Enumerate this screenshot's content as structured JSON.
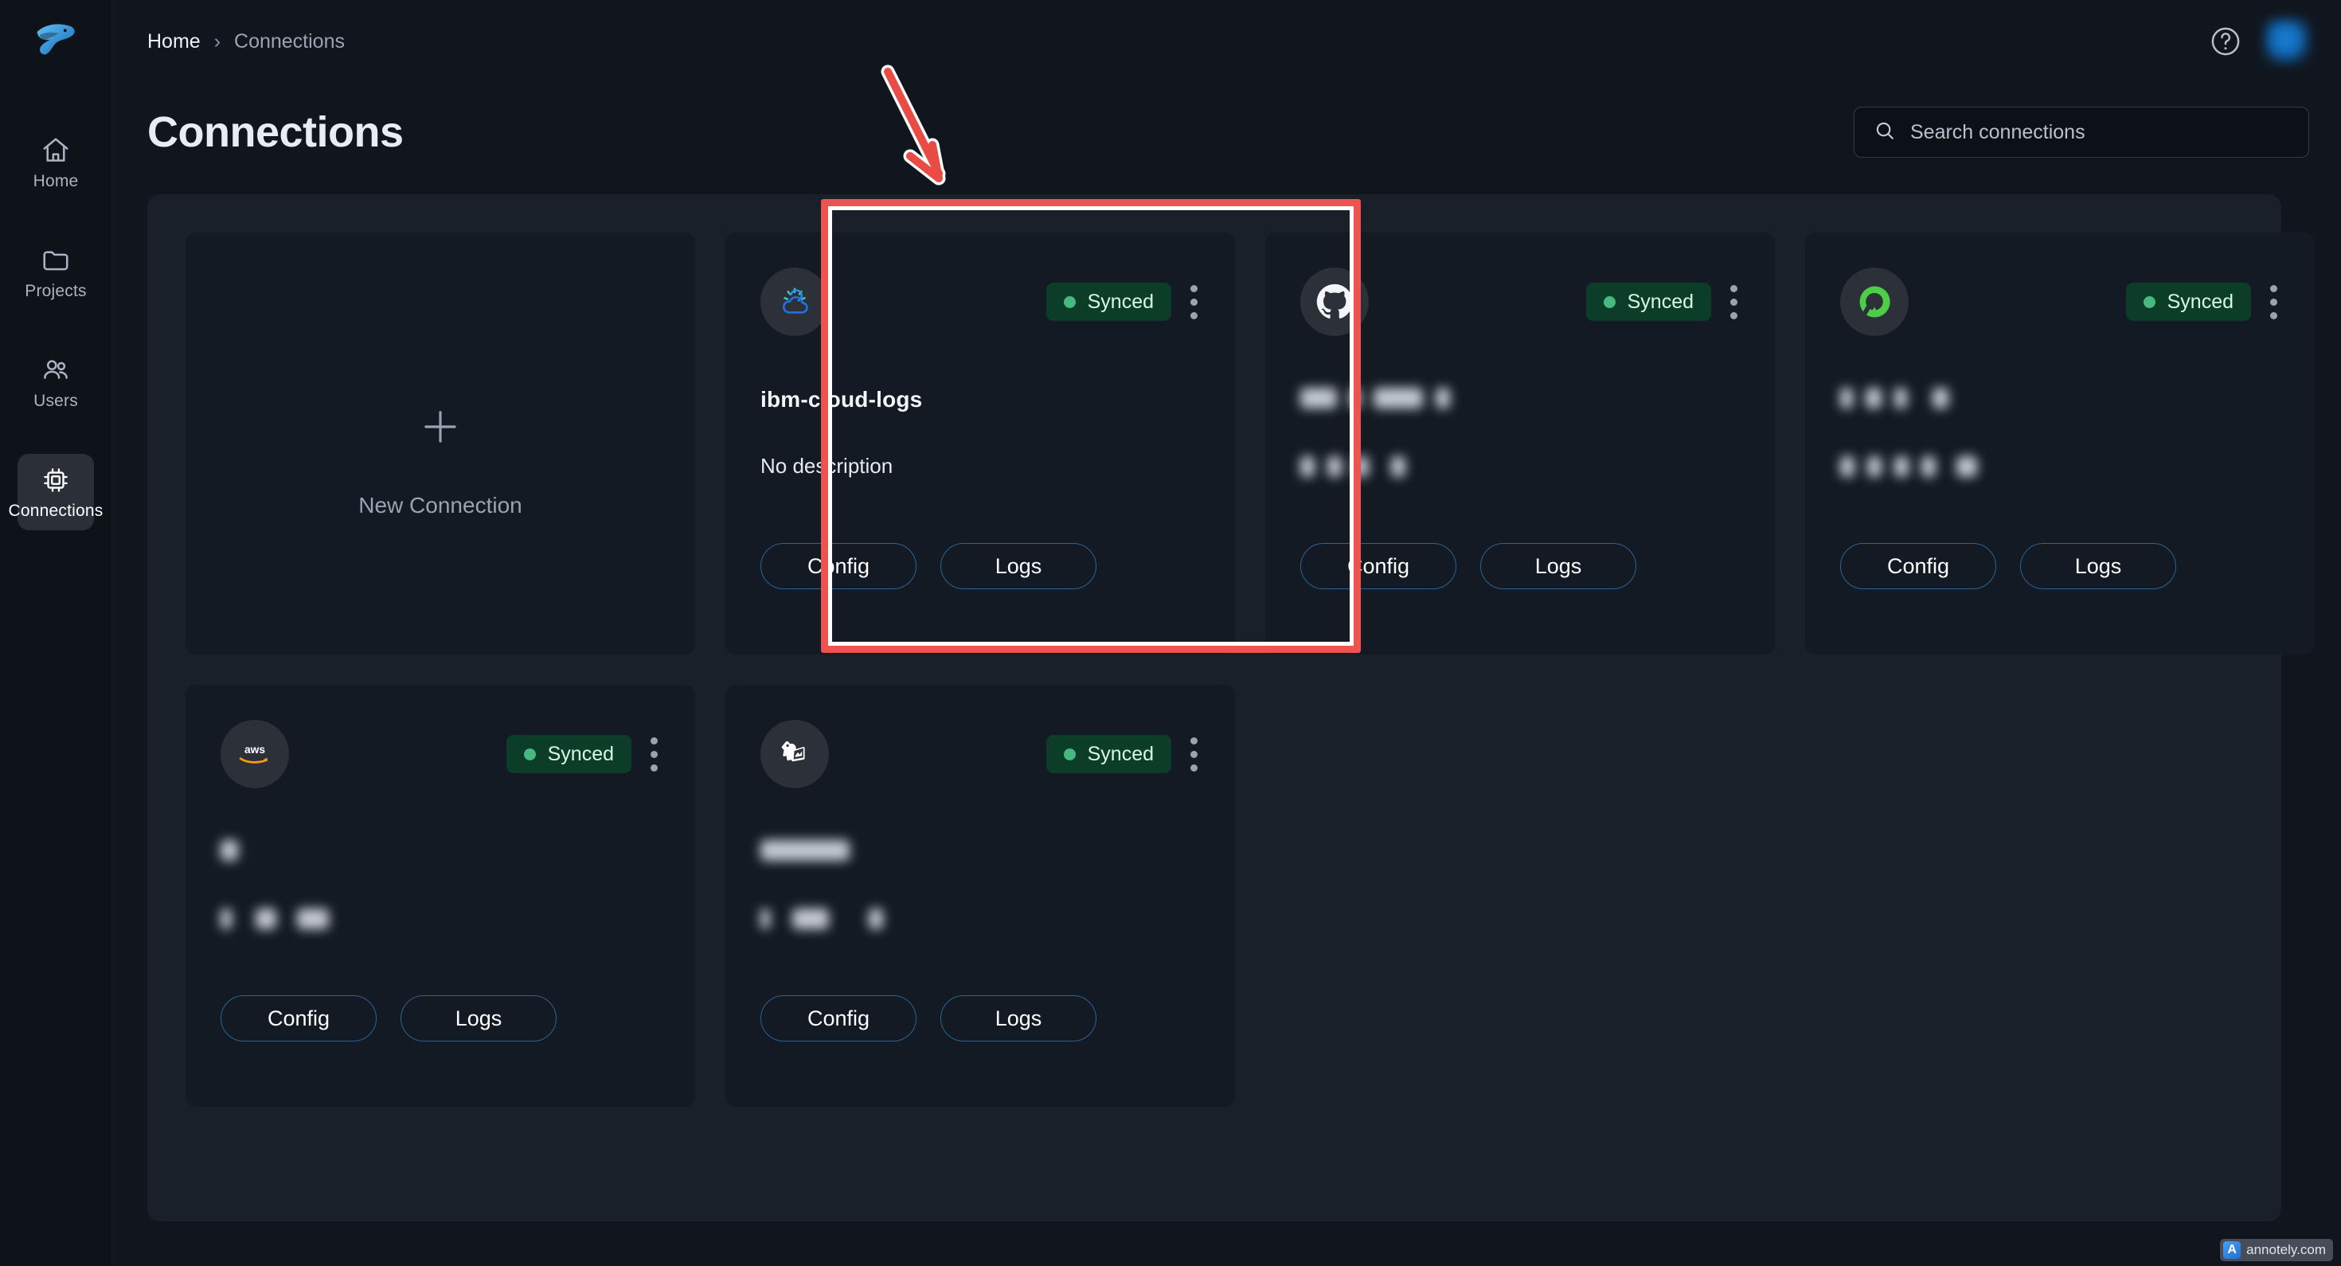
{
  "sidebar": {
    "brand_icon": "eagle-logo",
    "items": [
      {
        "label": "Home",
        "icon": "home-icon",
        "active": false
      },
      {
        "label": "Projects",
        "icon": "folder-icon",
        "active": false
      },
      {
        "label": "Users",
        "icon": "users-icon",
        "active": false
      },
      {
        "label": "Connections",
        "icon": "chip-icon",
        "active": true
      }
    ]
  },
  "topbar": {
    "breadcrumb": {
      "home": "Home",
      "separator": "›",
      "current": "Connections"
    },
    "help_icon": "help-circle-icon",
    "avatar": "user-avatar"
  },
  "header": {
    "title": "Connections"
  },
  "search": {
    "icon": "search-icon",
    "placeholder": "Search connections",
    "value": ""
  },
  "new_connection": {
    "icon": "plus-icon",
    "label": "New Connection"
  },
  "labels": {
    "config": "Config",
    "logs": "Logs",
    "synced": "Synced",
    "kebab": "more-options"
  },
  "colors": {
    "page_background": "#11161e",
    "sidebar_background": "#0e1319",
    "panel_background": "#1a2029",
    "card_background": "#131a23",
    "badge_background": "#0c3d28",
    "badge_dot": "#45b97e",
    "button_border": "#2a6397",
    "annotation_red": "#ef5350",
    "annotation_white": "#ffffff"
  },
  "connections": [
    {
      "logo": "ibm-cloud-icon",
      "status": "Synced",
      "name": "ibm-cloud-logs",
      "description": "No description",
      "name_redacted": false,
      "description_redacted": false,
      "buttons": [
        "Config",
        "Logs"
      ]
    },
    {
      "logo": "github-icon",
      "status": "Synced",
      "name": "",
      "description": "",
      "name_redacted": true,
      "description_redacted": true,
      "buttons": [
        "Config",
        "Logs"
      ]
    },
    {
      "logo": "newrelic-icon",
      "status": "Synced",
      "name": "",
      "description": "",
      "name_redacted": true,
      "description_redacted": true,
      "buttons": [
        "Config",
        "Logs"
      ]
    },
    {
      "logo": "aws-icon",
      "status": "Synced",
      "name": "",
      "description": "",
      "name_redacted": true,
      "description_redacted": true,
      "buttons": [
        "Config",
        "Logs"
      ]
    },
    {
      "logo": "datadog-icon",
      "status": "Synced",
      "name": "",
      "description": "",
      "name_redacted": true,
      "description_redacted": true,
      "buttons": [
        "Config",
        "Logs"
      ]
    }
  ],
  "annotations": {
    "highlight_target": "ibm-cloud-logs",
    "arrow": "down-arrow"
  },
  "watermark": {
    "badge": "A",
    "text": "annotely.com"
  }
}
